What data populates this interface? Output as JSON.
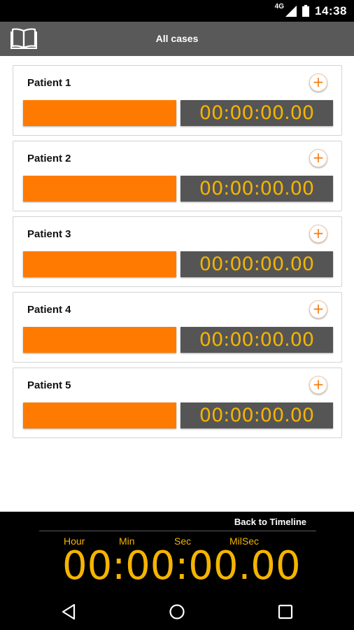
{
  "status_bar": {
    "network": "4G",
    "time": "14:38",
    "icons": [
      "signal-icon",
      "battery-icon"
    ]
  },
  "app_bar": {
    "title": "All cases",
    "icon": "book-icon"
  },
  "patients": [
    {
      "name": "Patient 1",
      "timer": "00:00:00.00",
      "add_icon": "+"
    },
    {
      "name": "Patient 2",
      "timer": "00:00:00.00",
      "add_icon": "+"
    },
    {
      "name": "Patient 3",
      "timer": "00:00:00.00",
      "add_icon": "+"
    },
    {
      "name": "Patient 4",
      "timer": "00:00:00.00",
      "add_icon": "+"
    },
    {
      "name": "Patient 5",
      "timer": "00:00:00.00",
      "add_icon": "+"
    }
  ],
  "timeline": {
    "back_label": "Back to Timeline",
    "units": {
      "hour": "Hour",
      "min": "Min",
      "sec": "Sec",
      "milsec": "MilSec"
    },
    "timer": "00:00:00.00"
  },
  "navigation": {
    "buttons": [
      "back-icon",
      "home-icon",
      "recents-icon"
    ]
  },
  "colors": {
    "accent_orange": "#ff7a00",
    "timer_yellow": "#f5b400",
    "app_bar_gray": "#595959",
    "timer_bg_gray": "#555555"
  }
}
